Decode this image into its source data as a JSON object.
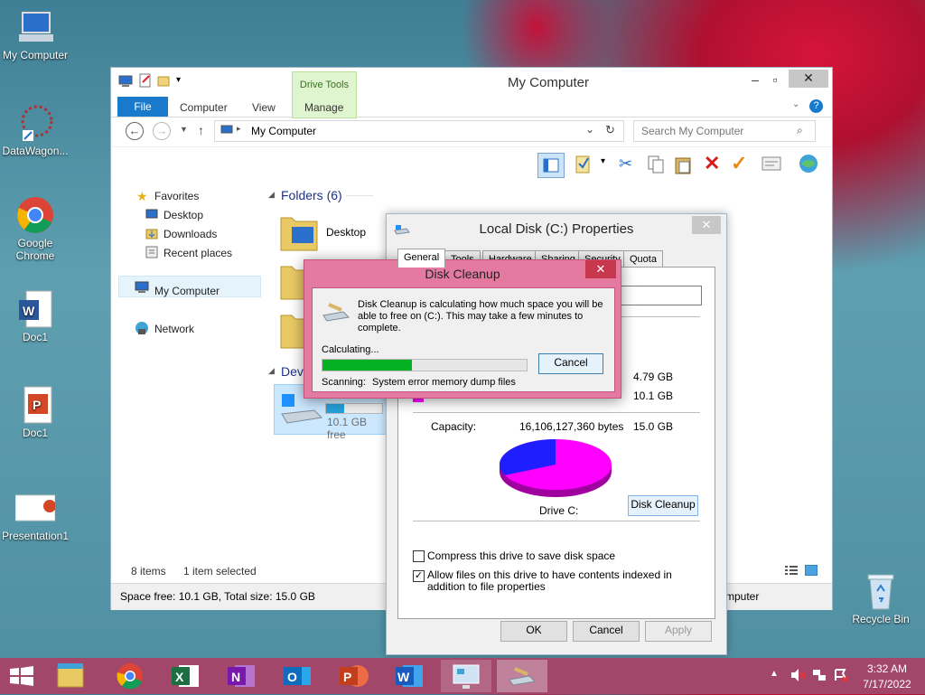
{
  "desktop": {
    "icons": [
      {
        "label": "My Computer"
      },
      {
        "label": "DataWagon..."
      },
      {
        "label": "Google Chrome"
      },
      {
        "label": "Doc1"
      },
      {
        "label": "Doc1"
      },
      {
        "label": "Presentation1"
      },
      {
        "label": "Recycle Bin"
      }
    ]
  },
  "explorer": {
    "title": "My Computer",
    "context_tab": "Drive Tools",
    "tabs": [
      "File",
      "Computer",
      "View",
      "Manage"
    ],
    "address": "My Computer",
    "search_placeholder": "Search My Computer",
    "nav": {
      "favorites": "Favorites",
      "desktop": "Desktop",
      "downloads": "Downloads",
      "recent": "Recent places",
      "mycomputer": "My Computer",
      "network": "Network"
    },
    "folders_header": "Folders (6)",
    "folder_desktop": "Desktop",
    "devices_header_partial": "Dev",
    "drive_free": "10.1 GB free",
    "status_items": "8 items",
    "status_selected": "1 item selected",
    "bottom_status": "Space free: 10.1 GB, Total size: 15.0 GB",
    "bottom_status_right": "mputer"
  },
  "properties": {
    "title": "Local Disk (C:) Properties",
    "tabs": [
      "General",
      "Tools",
      "Hardware",
      "Sharing",
      "Security",
      "Quota"
    ],
    "used_gb": "4.79 GB",
    "free_gb": "10.1 GB",
    "capacity_label": "Capacity:",
    "capacity_bytes": "16,106,127,360 bytes",
    "capacity_gb": "15.0 GB",
    "drive_label": "Drive C:",
    "disk_cleanup_button": "Disk Cleanup",
    "compress_label": "Compress this drive to save disk space",
    "index_label": "Allow files on this drive to have contents indexed in addition to file properties",
    "compress_checked": false,
    "index_checked": true,
    "ok": "OK",
    "cancel": "Cancel",
    "apply": "Apply",
    "used_fraction": 0.32
  },
  "cleanup": {
    "title": "Disk Cleanup",
    "message": "Disk Cleanup is calculating how much space you will be able to free on  (C:). This may take a few minutes to complete.",
    "calculating": "Calculating...",
    "cancel": "Cancel",
    "scanning_label": "Scanning:",
    "scanning_item": "System error memory dump files",
    "progress": 0.44
  },
  "taskbar": {
    "time": "3:32 AM",
    "date": "7/17/2022",
    "apps": [
      "File Explorer",
      "Google Chrome",
      "Excel",
      "OneNote",
      "Outlook",
      "PowerPoint",
      "Word",
      "Control Panel",
      "Disk Cleanup"
    ]
  },
  "colors": {
    "used": "#1e1eff",
    "free": "#ff00ff",
    "progress": "#06b025",
    "taskbar": "#a2466a",
    "accent": "#1979ca"
  }
}
